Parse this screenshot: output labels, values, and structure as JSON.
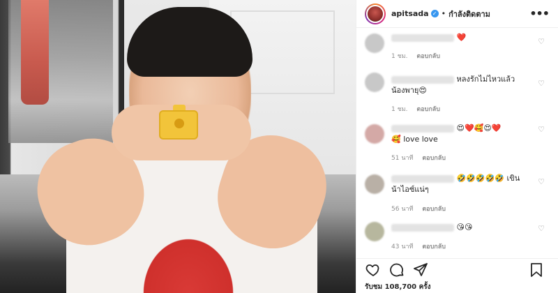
{
  "header": {
    "username": "apitsada",
    "verified_mark": "✓",
    "separator": "•",
    "follow_status": "กำลังติดตาม",
    "more_icon": "more-horizontal-icon"
  },
  "comments": [
    {
      "text": "",
      "emoji": "❤️",
      "time": "1 ชม.",
      "reply": "ตอบกลับ"
    },
    {
      "text": "หลงรักไม่ไหวแล้ว น้องพายุ😍",
      "emoji": "",
      "time": "1 ชม.",
      "reply": "ตอบกลับ"
    },
    {
      "text": "",
      "emoji": "😍❤️🥰😍❤️",
      "line2": "🥰 love love",
      "time": "51 นาที",
      "reply": "ตอบกลับ"
    },
    {
      "text": "",
      "emoji": "🤣🤣🤣🤣🤣 เขิน",
      "line2": "น้าไอซ์แน่ๆ",
      "time": "56 นาที",
      "reply": "ตอบกลับ"
    },
    {
      "text": "",
      "emoji": "😘😘",
      "time": "43 นาที",
      "reply": "ตอบกลับ"
    }
  ],
  "footer": {
    "likes_text": "รับชม 108,700 ครั้ง"
  },
  "colors": {
    "verified": "#3897f0",
    "heart_red": "#ed4956"
  }
}
